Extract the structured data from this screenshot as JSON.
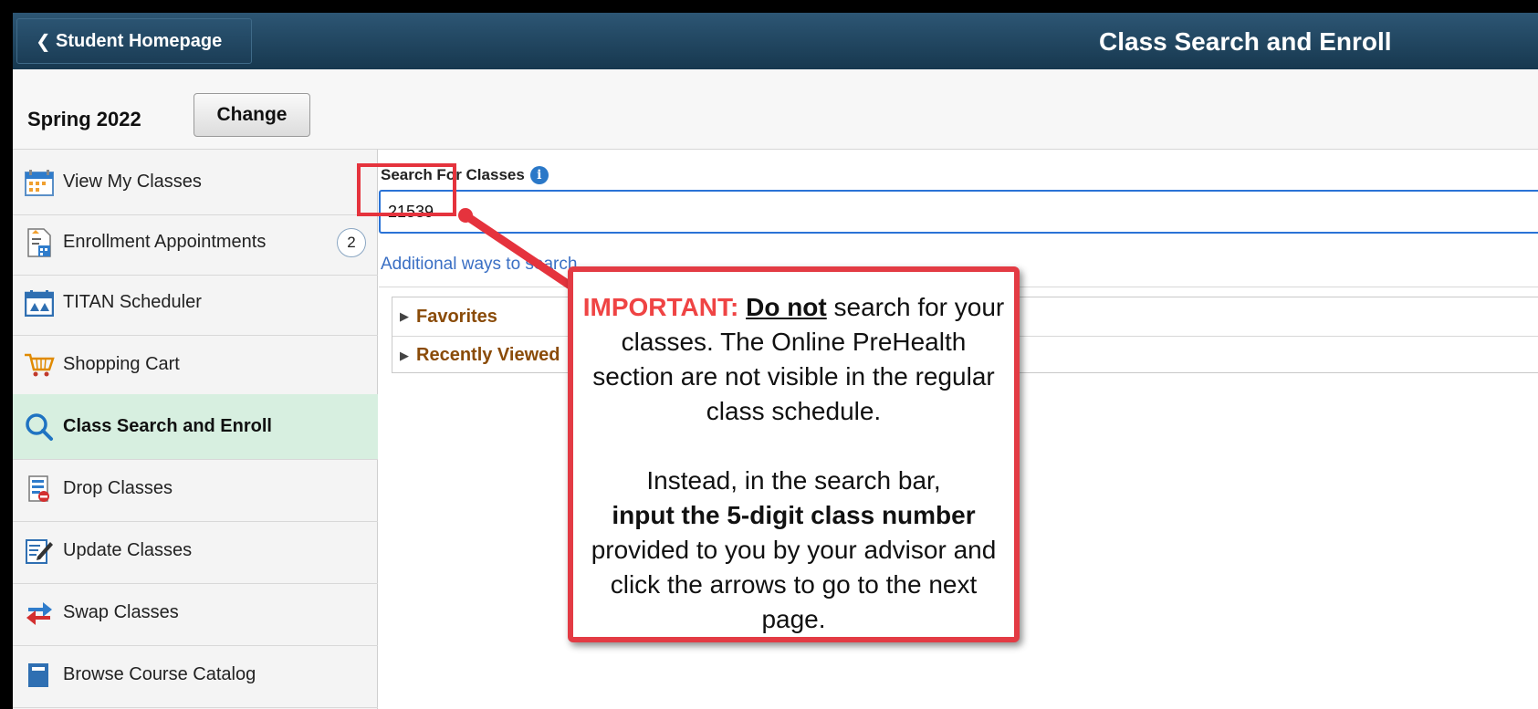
{
  "header": {
    "back_label": "Student Homepage",
    "title": "Class Search and Enroll"
  },
  "term": {
    "name": "Spring 2022",
    "change_label": "Change"
  },
  "sidebar": {
    "items": [
      {
        "label": "View My Classes",
        "icon": "calendar-icon"
      },
      {
        "label": "Enrollment Appointments",
        "icon": "appointments-icon",
        "badge": "2"
      },
      {
        "label": "TITAN Scheduler",
        "icon": "scheduler-icon"
      },
      {
        "label": "Shopping Cart",
        "icon": "cart-icon"
      },
      {
        "label": "Class Search and Enroll",
        "icon": "search-icon",
        "active": true
      },
      {
        "label": "Drop Classes",
        "icon": "drop-icon"
      },
      {
        "label": "Update Classes",
        "icon": "edit-icon"
      },
      {
        "label": "Swap Classes",
        "icon": "swap-icon"
      },
      {
        "label": "Browse Course Catalog",
        "icon": "catalog-icon"
      }
    ]
  },
  "search": {
    "label": "Search For Classes",
    "value": "21539",
    "additional_link": "Additional ways to search"
  },
  "accordion": {
    "favorites": "Favorites",
    "recently_viewed": "Recently Viewed"
  },
  "callout": {
    "important": "IMPORTANT:",
    "do_not": "Do not",
    "line1_rest": " search for your classes. The Online PreHealth section are not visible in the regular class schedule.",
    "line2_start": "Instead, in the search bar,",
    "line2_bold": "input the 5-digit class number",
    "line2_end": "provided to you by your advisor and click the arrows to go to the next page."
  },
  "colors": {
    "header": "#1f4560",
    "accent_red": "#e33b44",
    "active_nav": "#d7efe0",
    "link": "#3a6fc4"
  }
}
